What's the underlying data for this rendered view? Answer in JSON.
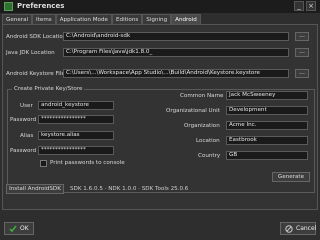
{
  "window": {
    "title": "Preferences",
    "minimize": "_",
    "close": "×"
  },
  "tabs": [
    {
      "label": "General"
    },
    {
      "label": "Items"
    },
    {
      "label": "Application Mode"
    },
    {
      "label": "Editions"
    },
    {
      "label": "Signing"
    },
    {
      "label": "Android"
    }
  ],
  "android": {
    "sdk_label": "Android SDK Location",
    "sdk_value": "C:\\Android\\android-sdk",
    "jdk_label": "Java JDK Location",
    "jdk_value": "C:\\Program Files\\Java\\jdk1.8.0_",
    "keystore_label": "Android Keystore File",
    "keystore_value": "C:\\Users\\...\\Workspace\\App Studio\\...\\Build\\Android\\Keystore.keystore",
    "browse_label": "..."
  },
  "keystore": {
    "group_title": "Create Private Key/Store",
    "user_label": "User",
    "user_value": "android_keystore",
    "password_label": "Password",
    "password_value": "****************",
    "alias_label": "Alias",
    "alias_value": "keystore.alias",
    "alias_password_label": "Password",
    "alias_password_value": "****************",
    "common_name_label": "Common Name",
    "common_name_value": "Jack McSweeney",
    "org_unit_label": "Organizational Unit",
    "org_unit_value": "Development",
    "org_label": "Organization",
    "org_value": "Acme Inc.",
    "location_label": "Location",
    "location_value": "Eastbrook",
    "country_label": "Country",
    "country_value": "GB",
    "print_label": "Print passwords to console",
    "generate_label": "Generate"
  },
  "footer": {
    "install_button": "Install AndroidSDK",
    "status_text": "SDK 1.6.0.5  ·  NDK 1.0.0  ·  SDK Tools 25.0.6"
  },
  "dialog": {
    "ok_label": "OK",
    "cancel_label": "Cancel"
  },
  "colors": {
    "ok_icon": "#3faa3f",
    "cancel_icon": "#c8c8c8",
    "title_icon": "#2f6f2f"
  }
}
